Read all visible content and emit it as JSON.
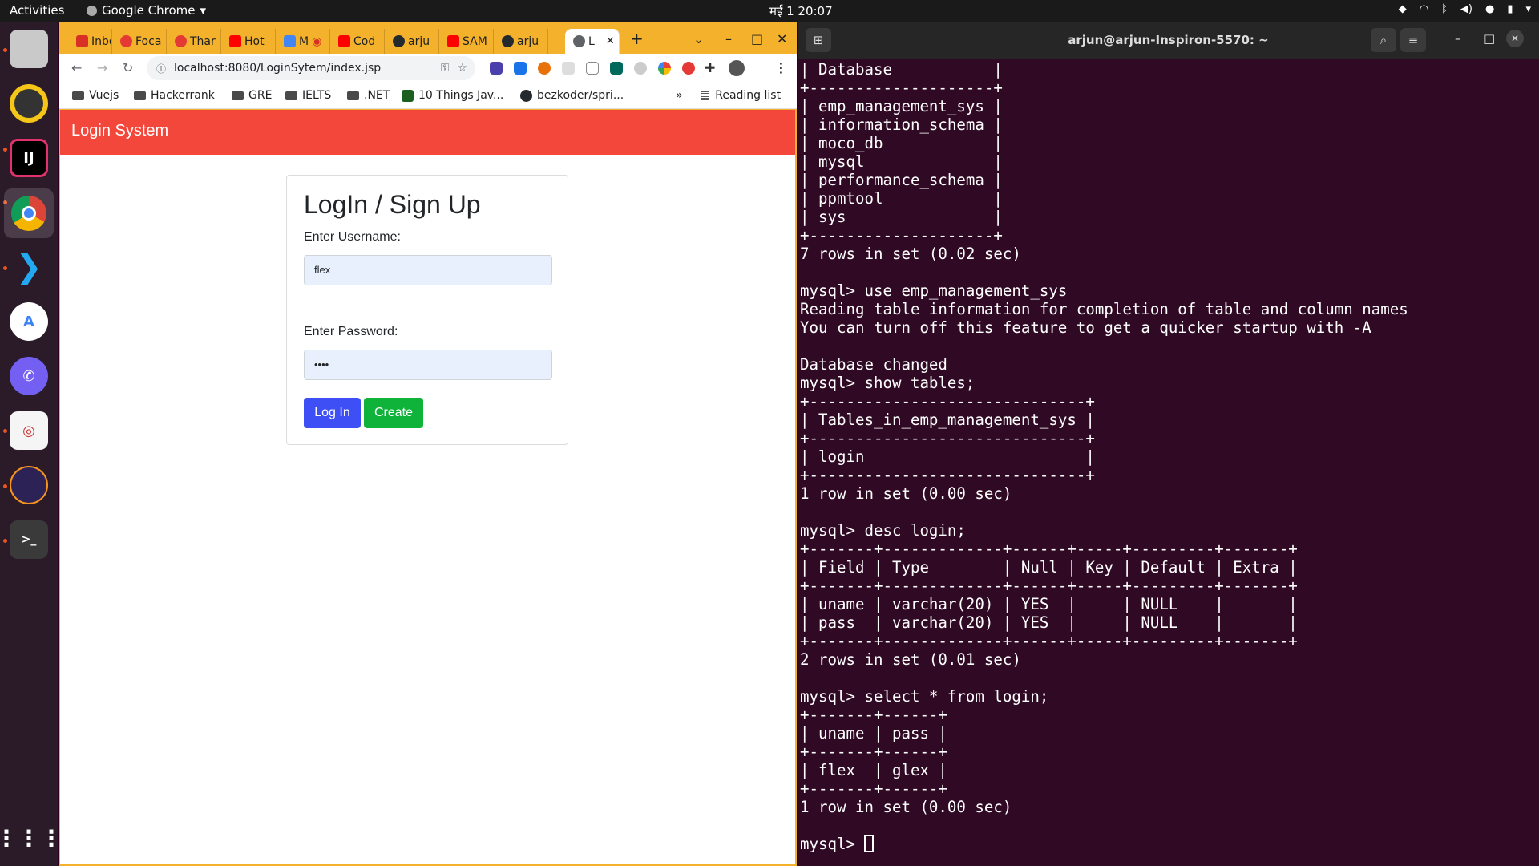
{
  "topbar": {
    "activities": "Activities",
    "app_name": "Google Chrome",
    "clock": "मई 1  20:07"
  },
  "chrome": {
    "tabs": [
      {
        "label": "Inbo",
        "color": "#d93025"
      },
      {
        "label": "Foca",
        "color": "#e53935"
      },
      {
        "label": "Thar",
        "color": "#e53935"
      },
      {
        "label": "Hot",
        "color": "#ff0000"
      },
      {
        "label": "M",
        "color": "#4285f4"
      },
      {
        "label": "Cod",
        "color": "#ff0000"
      },
      {
        "label": "arju",
        "color": "#24292e"
      },
      {
        "label": "SAM",
        "color": "#ff0000"
      },
      {
        "label": "arju",
        "color": "#24292e"
      },
      {
        "label": "L",
        "color": "#5f6368"
      }
    ],
    "new_tab": "+",
    "url": "localhost:8080/LoginSytem/index.jsp",
    "bookmarks": [
      "Vuejs",
      "Hackerrank",
      "GRE",
      "IELTS",
      ".NET",
      "10 Things Jav...",
      "bezkoder/spri..."
    ],
    "bookmarks_more": "»",
    "reading_list": "Reading list"
  },
  "page": {
    "brand": "Login System",
    "heading": "LogIn / Sign Up",
    "username_label": "Enter Username:",
    "username_value": "flex",
    "password_label": "Enter Password:",
    "password_value": "••••",
    "login_button": "Log In",
    "create_button": "Create",
    "colors": {
      "navbar": "#f4473b",
      "login": "#3d4ff5",
      "create": "#0fb33a"
    }
  },
  "terminal": {
    "title": "arjun@arjun-Inspiron-5570: ~",
    "lines": [
      "| Database           |",
      "+--------------------+",
      "| emp_management_sys |",
      "| information_schema |",
      "| moco_db            |",
      "| mysql              |",
      "| performance_schema |",
      "| ppmtool            |",
      "| sys                |",
      "+--------------------+",
      "7 rows in set (0.02 sec)",
      "",
      "mysql> use emp_management_sys",
      "Reading table information for completion of table and column names",
      "You can turn off this feature to get a quicker startup with -A",
      "",
      "Database changed",
      "mysql> show tables;",
      "+------------------------------+",
      "| Tables_in_emp_management_sys |",
      "+------------------------------+",
      "| login                        |",
      "+------------------------------+",
      "1 row in set (0.00 sec)",
      "",
      "mysql> desc login;",
      "+-------+-------------+------+-----+---------+-------+",
      "| Field | Type        | Null | Key | Default | Extra |",
      "+-------+-------------+------+-----+---------+-------+",
      "| uname | varchar(20) | YES  |     | NULL    |       |",
      "| pass  | varchar(20) | YES  |     | NULL    |       |",
      "+-------+-------------+------+-----+---------+-------+",
      "2 rows in set (0.01 sec)",
      "",
      "mysql> select * from login;",
      "+-------+------+",
      "| uname | pass |",
      "+-------+------+",
      "| flex  | glex |",
      "+-------+------+",
      "1 row in set (0.00 sec)",
      ""
    ],
    "prompt": "mysql> "
  }
}
